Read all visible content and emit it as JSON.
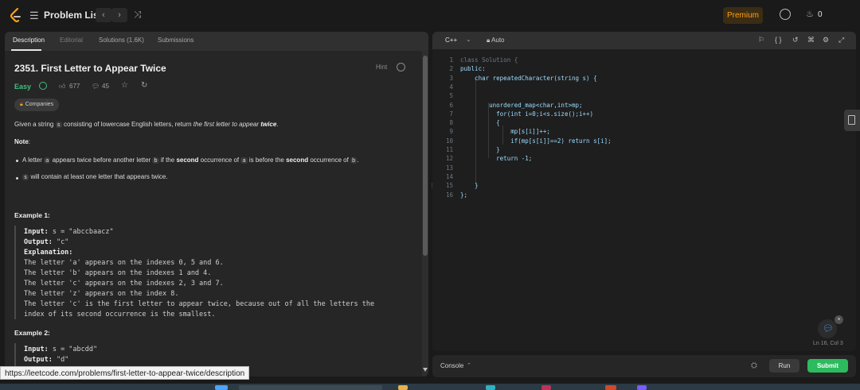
{
  "topbar": {
    "problem_list_label": "Problem List",
    "prev_icon": "chevron-left-icon",
    "next_icon": "chevron-right-icon",
    "premium_label": "Premium",
    "streak_count": "0"
  },
  "tabs": [
    {
      "label": "Description"
    },
    {
      "label": "Editorial"
    },
    {
      "label": "Solutions (1.6K)"
    },
    {
      "label": "Submissions"
    }
  ],
  "problem": {
    "title": "2351. First Letter to Appear Twice",
    "hint_label": "Hint",
    "difficulty": "Easy",
    "likes": "677",
    "comments": "45",
    "companies_label": "Companies",
    "statement_pre": "Given a string ",
    "statement_var": "s",
    "statement_mid": " consisting of lowercase English letters, return ",
    "statement_em": "the first letter to appear ",
    "statement_bold": "twice",
    "statement_end": ".",
    "note_label": "Note",
    "note_colon": ":",
    "bullet1_a": "A letter ",
    "bullet1_var_a": "a",
    "bullet1_b": " appears twice before another letter ",
    "bullet1_var_b": "b",
    "bullet1_c": " if the ",
    "bullet1_second1": "second",
    "bullet1_d": " occurrence of ",
    "bullet1_var_a2": "a",
    "bullet1_e": " is before the ",
    "bullet1_second2": "second",
    "bullet1_f": " occurrence of ",
    "bullet1_var_b2": "b",
    "bullet1_g": ".",
    "bullet2_var": "s",
    "bullet2_text": " will contain at least one letter that appears twice."
  },
  "example1": {
    "heading": "Example 1:",
    "input_label": "Input:",
    "input_value": " s = \"abccbaacz\"",
    "output_label": "Output:",
    "output_value": " \"c\"",
    "explanation_label": "Explanation:",
    "lines": [
      "The letter 'a' appears on the indexes 0, 5 and 6.",
      "The letter 'b' appears on the indexes 1 and 4.",
      "The letter 'c' appears on the indexes 2, 3 and 7.",
      "The letter 'z' appears on the index 8.",
      "The letter 'c' is the first letter to appear twice, because out of all the letters the",
      "index of its second occurrence is the smallest."
    ]
  },
  "example2": {
    "heading": "Example 2:",
    "input_label": "Input:",
    "input_value": " s = \"abcdd\"",
    "output_label": "Output:",
    "output_value": " \"d\""
  },
  "status_url": "https://leetcode.com/problems/first-letter-to-appear-twice/description",
  "editor": {
    "language": "C++",
    "mode": "Auto",
    "cursor_position": "Ln 16, Col 3",
    "line_numbers": [
      "1",
      "2",
      "3",
      "4",
      "5",
      "6",
      "7",
      "8",
      "9",
      "10",
      "11",
      "12",
      "13",
      "14",
      "15",
      "16"
    ],
    "code_lines": [
      "class Solution {",
      "public:",
      "    char repeatedCharacter(string s) {",
      "",
      "",
      "        unordered_map<char,int>mp;",
      "          for(int i=0;i<s.size();i++)",
      "          {",
      "              mp[s[i]]++;",
      "              if(mp[s[i]]==2) return s[i];",
      "          }",
      "          return -1;",
      "",
      "",
      "    }",
      "};"
    ]
  },
  "console": {
    "label": "Console",
    "run_label": "Run",
    "submit_label": "Submit"
  },
  "colors": {
    "accent_orange": "#ffa116",
    "easy_green": "#3fbf7f",
    "submit_green": "#2cbb5d"
  }
}
